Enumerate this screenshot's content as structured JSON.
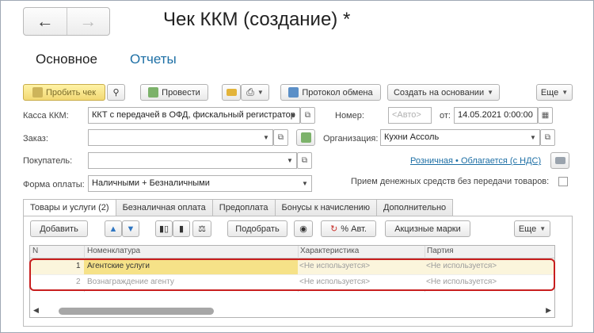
{
  "window": {
    "title": "Чек ККМ (создание) *"
  },
  "nav": {
    "back_icon": "arrow-left-icon",
    "forward_icon": "arrow-right-icon"
  },
  "section_tabs": {
    "main": "Основное",
    "reports": "Отчеты"
  },
  "toolbar": {
    "punch_check": "Пробить чек",
    "post": "Провести",
    "exchange_log": "Протокол обмена",
    "create_based_on": "Создать на основании",
    "more": "Еще"
  },
  "form": {
    "register_label": "Касса ККМ:",
    "register_value": "ККТ с передачей в ОФД, фискальный регистратор",
    "number_label": "Номер:",
    "number_placeholder": "<Авто>",
    "date_label": "от:",
    "date_value": "14.05.2021  0:00:00",
    "order_label": "Заказ:",
    "order_value": "",
    "organization_label": "Организация:",
    "organization_value": "Кухни Ассоль",
    "buyer_label": "Покупатель:",
    "buyer_value": "",
    "tax_link": "Розничная • Облагается (с НДС)",
    "payment_label": "Форма оплаты:",
    "payment_value": "Наличными + Безналичными",
    "no_cash_label": "Прием денежных средств без передачи товаров:"
  },
  "tabs": [
    {
      "label": "Товары и услуги (2)"
    },
    {
      "label": "Безналичная оплата"
    },
    {
      "label": "Предоплата"
    },
    {
      "label": "Бонусы к начислению"
    },
    {
      "label": "Дополнительно"
    }
  ],
  "table_toolbar": {
    "add": "Добавить",
    "pick": "Подобрать",
    "percent_auto": "% Авт.",
    "excise": "Акцизные марки",
    "more": "Еще"
  },
  "table": {
    "headers": [
      "N",
      "Номенклатура",
      "Характеристика",
      "Партия"
    ],
    "rows": [
      {
        "n": "1",
        "name": "Агентские услуги",
        "characteristic": "<Не используется>",
        "batch": "<Не используется>"
      },
      {
        "n": "2",
        "name": "Вознаграждение агенту",
        "characteristic": "<Не используется>",
        "batch": "<Не используется>"
      }
    ]
  },
  "colors": {
    "accent": "#f2d873",
    "link": "#1d6fa5",
    "highlight": "#c81e1e"
  }
}
